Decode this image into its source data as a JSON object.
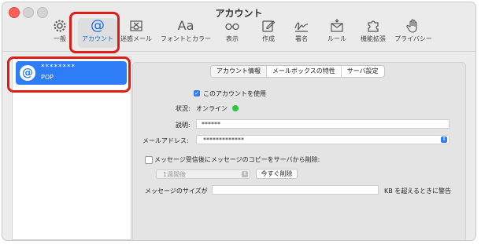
{
  "window": {
    "title": "アカウント"
  },
  "toolbar": {
    "items": [
      {
        "label": "一般",
        "icon": "gear-icon"
      },
      {
        "label": "アカウント",
        "icon": "at-sign-icon"
      },
      {
        "label": "迷惑メール",
        "icon": "junk-mail-icon"
      },
      {
        "label": "フォントとカラー",
        "icon": "fonts-icon",
        "glyph": "Aa"
      },
      {
        "label": "表示",
        "icon": "glasses-icon"
      },
      {
        "label": "作成",
        "icon": "compose-icon"
      },
      {
        "label": "署名",
        "icon": "signature-icon"
      },
      {
        "label": "ルール",
        "icon": "rules-icon"
      },
      {
        "label": "機能拡張",
        "icon": "extensions-icon"
      },
      {
        "label": "プライバシー",
        "icon": "privacy-hand-icon"
      }
    ]
  },
  "sidebar": {
    "account": {
      "name": "********",
      "type": "POP",
      "icon": "at-sign-icon"
    }
  },
  "tabs": [
    "アカウント情報",
    "メールボックスの特性",
    "サーバ設定"
  ],
  "form": {
    "enable_label": "このアカウントを使用",
    "status_label": "状況:",
    "status_value": "オンライン",
    "status_color": "#28c840",
    "description_label": "説明:",
    "description_value": "******",
    "email_label": "メールアドレス:",
    "email_value": "*************",
    "remove_copy_label": "メッセージ受信後にメッセージのコピーをサーバから削除:",
    "remove_period": "1週間後",
    "remove_now_button": "今すぐ削除",
    "size_label": "メッセージのサイズが",
    "size_suffix": "KB を超えるときに警告"
  },
  "colors": {
    "accent": "#2e7df6",
    "highlight": "#e01c17"
  }
}
